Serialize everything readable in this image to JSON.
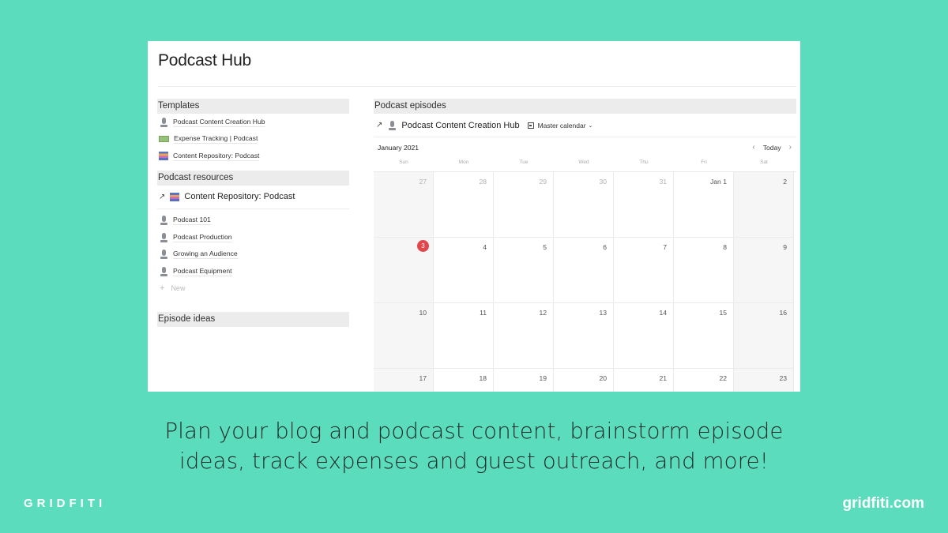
{
  "page": {
    "title": "Podcast Hub"
  },
  "templates": {
    "heading": "Templates",
    "items": [
      {
        "label": "Podcast Content Creation Hub",
        "icon": "microphone-icon"
      },
      {
        "label": "Expense Tracking | Podcast",
        "icon": "money-icon"
      },
      {
        "label": "Content Repository: Podcast",
        "icon": "books-icon"
      }
    ]
  },
  "resources": {
    "heading": "Podcast resources",
    "linked_db": {
      "label": "Content Repository: Podcast",
      "arrow": "↗",
      "icon": "books-icon"
    },
    "items": [
      {
        "label": "Podcast 101",
        "icon": "microphone-icon"
      },
      {
        "label": "Podcast Production",
        "icon": "microphone-icon"
      },
      {
        "label": "Growing an Audience",
        "icon": "microphone-icon"
      },
      {
        "label": "Podcast Equipment",
        "icon": "microphone-icon"
      }
    ],
    "new_label": "New",
    "new_icon": "+"
  },
  "ideas": {
    "heading": "Episode ideas"
  },
  "episodes": {
    "heading": "Podcast episodes",
    "linked_db": {
      "label": "Podcast Content Creation Hub",
      "arrow": "↗",
      "icon": "microphone-icon"
    },
    "view": {
      "label": "Master calendar",
      "caret": "⌄"
    },
    "month": "January 2021",
    "nav": {
      "prev": "‹",
      "today": "Today",
      "next": "›"
    },
    "weekdays": [
      "Sun",
      "Mon",
      "Tue",
      "Wed",
      "Thu",
      "Fri",
      "Sat"
    ],
    "weeks": [
      [
        "27",
        "28",
        "29",
        "30",
        "31",
        "Jan 1",
        "2"
      ],
      [
        "3",
        "4",
        "5",
        "6",
        "7",
        "8",
        "9"
      ],
      [
        "10",
        "11",
        "12",
        "13",
        "14",
        "15",
        "16"
      ],
      [
        "17",
        "18",
        "19",
        "20",
        "21",
        "22",
        "23"
      ]
    ],
    "today": "3",
    "today_color": "#e0484c"
  },
  "caption": {
    "line1": "Plan your blog and podcast content, brainstorm episode",
    "line2": "ideas, track expenses and guest outreach, and more!"
  },
  "brand": {
    "left": "GRIDFITI",
    "right": "gridfiti.com",
    "background": "#5adcbd"
  }
}
